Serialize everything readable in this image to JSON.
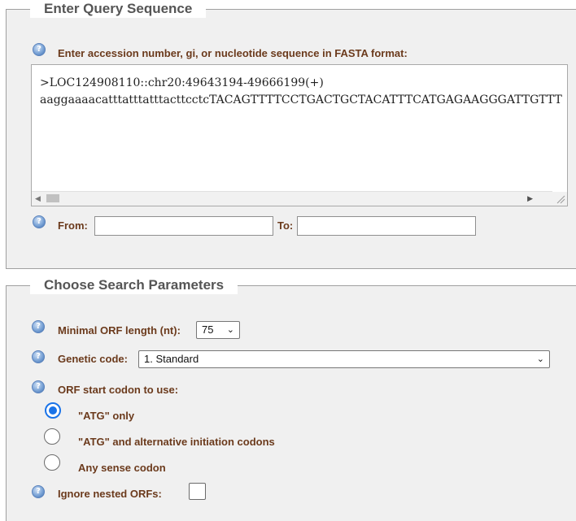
{
  "query": {
    "legend": "Enter Query Sequence",
    "instruction": "Enter accession number, gi, or nucleotide sequence in FASTA format:",
    "sequence_line1": ">LOC124908110::chr20:49643194-49666199(+)",
    "sequence_line2": "aaggaaaacatttatttatttacttcctcTACAGTTTTCCTGACTGCTACATTTCATGAGAAGGGATTGTTT",
    "from_label": "From:",
    "from_value": "",
    "to_label": "To:",
    "to_value": ""
  },
  "params": {
    "legend": "Choose Search Parameters",
    "min_orf_label": "Minimal ORF length (nt):",
    "min_orf_value": "75",
    "genetic_code_label": "Genetic code:",
    "genetic_code_value": "1. Standard",
    "start_codon_label": "ORF start codon to use:",
    "start_codon_options": [
      {
        "label": "\"ATG\" only",
        "selected": true
      },
      {
        "label": "\"ATG\" and alternative initiation codons",
        "selected": false
      },
      {
        "label": "Any sense codon",
        "selected": false
      }
    ],
    "ignore_nested_label": "Ignore nested ORFs:",
    "ignore_nested_checked": false
  },
  "icons": {
    "help": "help-icon",
    "help_glyph": "?"
  },
  "colors": {
    "label": "#6b3a1c",
    "legend": "#555555",
    "panel": "#f0f0f0",
    "radio_accent": "#1a73e8"
  }
}
